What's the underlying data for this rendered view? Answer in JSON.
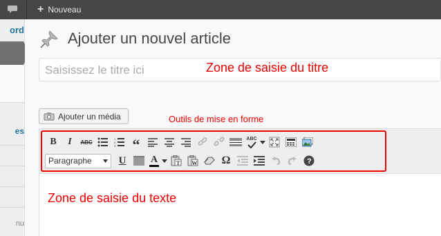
{
  "adminbar": {
    "new_label": "Nouveau"
  },
  "sidebar": {
    "dashboard_fragment": "ord",
    "item_fragment": "es",
    "menu_fragment": "nu"
  },
  "page": {
    "title": "Ajouter un nouvel article"
  },
  "title_field": {
    "placeholder": "Saisissez le titre ici",
    "value": ""
  },
  "media": {
    "button_label": "Ajouter un média"
  },
  "annotations": {
    "title_zone": "Zone de saisie du titre",
    "tools": "Outils de mise en forme",
    "text_zone": "Zone de saisie du texte"
  },
  "toolbar": {
    "row1_icons": [
      "bold-icon",
      "italic-icon",
      "strikethrough-icon",
      "bullet-list-icon",
      "numbered-list-icon",
      "blockquote-icon",
      "align-left-icon",
      "align-center-icon",
      "align-right-icon",
      "link-icon",
      "unlink-icon",
      "more-tag-icon",
      "spellcheck-icon",
      "fullscreen-icon",
      "kitchen-sink-icon",
      "media-icon"
    ],
    "row2_icons": [
      "underline-icon",
      "justify-icon",
      "text-color-icon",
      "paste-text-icon",
      "paste-word-icon",
      "clear-format-icon",
      "special-char-icon",
      "outdent-icon",
      "indent-icon",
      "undo-icon",
      "redo-icon",
      "help-icon"
    ],
    "format_select_value": "Paragraphe",
    "bold_glyph": "B",
    "italic_glyph": "I",
    "strike_glyph": "ABC",
    "quote_glyph": "“",
    "spell_glyph": "ABC",
    "underline_glyph": "U",
    "text_color_glyph": "A",
    "omega_glyph": "Ω"
  },
  "colors": {
    "annotation": "#e00000",
    "adminbar": "#464646",
    "link": "#21759b"
  }
}
